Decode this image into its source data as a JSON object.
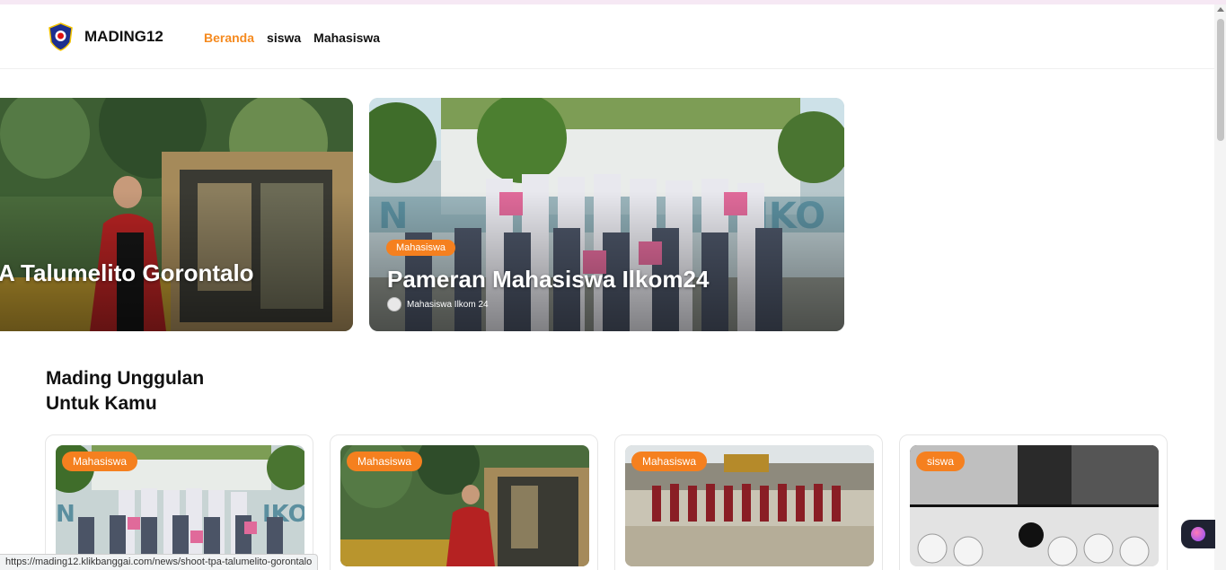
{
  "header": {
    "brand": "MADING12",
    "nav": [
      {
        "label": "Beranda",
        "active": true
      },
      {
        "label": "siswa",
        "active": false
      },
      {
        "label": "Mahasiswa",
        "active": false
      }
    ]
  },
  "hero": [
    {
      "title": "A Talumelito Gorontalo"
    },
    {
      "category": "Mahasiswa",
      "title": "Pameran Mahasiswa Ilkom24",
      "author": "Mahasiswa Ilkom 24"
    }
  ],
  "section": {
    "title_line1": "Mading Unggulan",
    "title_line2": "Untuk Kamu"
  },
  "cards": [
    {
      "category": "Mahasiswa"
    },
    {
      "category": "Mahasiswa"
    },
    {
      "category": "Mahasiswa"
    },
    {
      "category": "siswa"
    }
  ],
  "status_url": "https://mading12.klikbanggai.com/news/shoot-tpa-talumelito-gorontalo",
  "colors": {
    "accent": "#f58a1f",
    "badge": "#f5801f"
  }
}
